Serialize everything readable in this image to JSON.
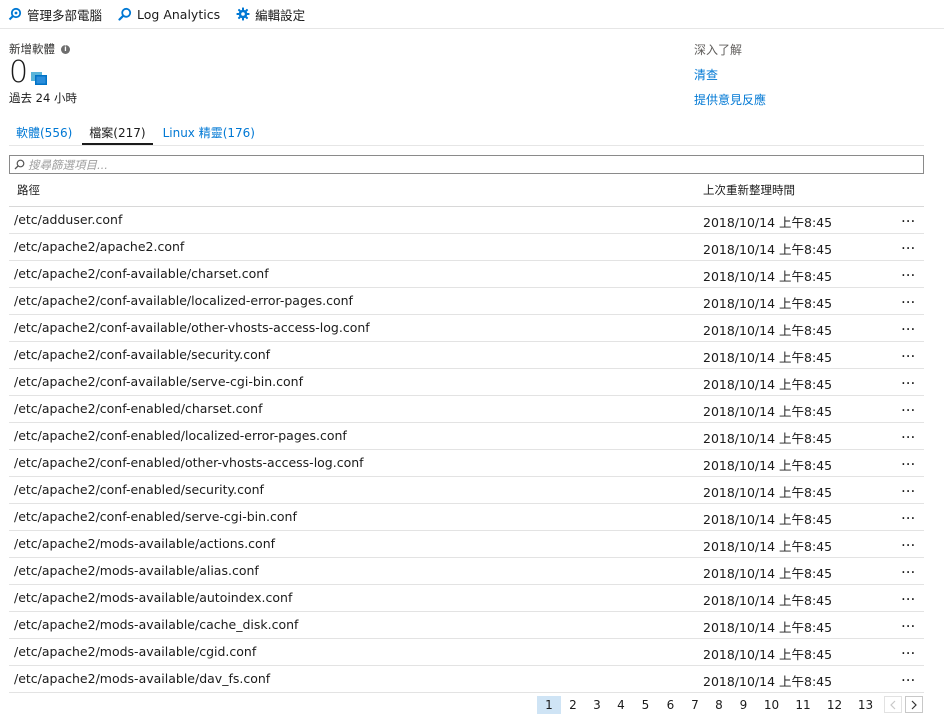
{
  "toolbar": {
    "manage_label": "管理多部電腦",
    "log_analytics_label": "Log Analytics",
    "edit_settings_label": "編輯設定"
  },
  "summary": {
    "title": "新增軟體",
    "count": "0",
    "period": "過去 24 小時"
  },
  "learn_more": {
    "heading": "深入了解",
    "links": [
      "清查",
      "提供意見反應"
    ]
  },
  "tabs": [
    {
      "label": "軟體(556)"
    },
    {
      "label": "檔案(217)"
    },
    {
      "label": "Linux 精靈(176)"
    }
  ],
  "search": {
    "placeholder": "搜尋篩選項目..."
  },
  "table": {
    "columns": [
      "路徑",
      "上次重新整理時間"
    ],
    "rows": [
      {
        "path": "/etc/adduser.conf",
        "time": "2018/10/14 上午8:45"
      },
      {
        "path": "/etc/apache2/apache2.conf",
        "time": "2018/10/14 上午8:45"
      },
      {
        "path": "/etc/apache2/conf-available/charset.conf",
        "time": "2018/10/14 上午8:45"
      },
      {
        "path": "/etc/apache2/conf-available/localized-error-pages.conf",
        "time": "2018/10/14 上午8:45"
      },
      {
        "path": "/etc/apache2/conf-available/other-vhosts-access-log.conf",
        "time": "2018/10/14 上午8:45"
      },
      {
        "path": "/etc/apache2/conf-available/security.conf",
        "time": "2018/10/14 上午8:45"
      },
      {
        "path": "/etc/apache2/conf-available/serve-cgi-bin.conf",
        "time": "2018/10/14 上午8:45"
      },
      {
        "path": "/etc/apache2/conf-enabled/charset.conf",
        "time": "2018/10/14 上午8:45"
      },
      {
        "path": "/etc/apache2/conf-enabled/localized-error-pages.conf",
        "time": "2018/10/14 上午8:45"
      },
      {
        "path": "/etc/apache2/conf-enabled/other-vhosts-access-log.conf",
        "time": "2018/10/14 上午8:45"
      },
      {
        "path": "/etc/apache2/conf-enabled/security.conf",
        "time": "2018/10/14 上午8:45"
      },
      {
        "path": "/etc/apache2/conf-enabled/serve-cgi-bin.conf",
        "time": "2018/10/14 上午8:45"
      },
      {
        "path": "/etc/apache2/mods-available/actions.conf",
        "time": "2018/10/14 上午8:45"
      },
      {
        "path": "/etc/apache2/mods-available/alias.conf",
        "time": "2018/10/14 上午8:45"
      },
      {
        "path": "/etc/apache2/mods-available/autoindex.conf",
        "time": "2018/10/14 上午8:45"
      },
      {
        "path": "/etc/apache2/mods-available/cache_disk.conf",
        "time": "2018/10/14 上午8:45"
      },
      {
        "path": "/etc/apache2/mods-available/cgid.conf",
        "time": "2018/10/14 上午8:45"
      },
      {
        "path": "/etc/apache2/mods-available/dav_fs.conf",
        "time": "2018/10/14 上午8:45"
      }
    ],
    "more_label": "..."
  },
  "pagination": {
    "pages": [
      "1",
      "2",
      "3",
      "4",
      "5",
      "6",
      "7",
      "8",
      "9",
      "10",
      "11",
      "12",
      "13"
    ],
    "current": "1"
  },
  "colors": {
    "link": "#0078d4",
    "active_page_bg": "#cfe4f5",
    "text": "#1b1b1b"
  }
}
